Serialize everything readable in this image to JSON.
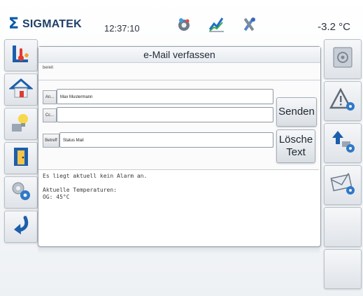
{
  "header": {
    "logo_text": "SIGMATEK",
    "time": "12:37:10",
    "temperature": "-3.2 °C"
  },
  "panel": {
    "title": "e-Mail verfassen",
    "status": "bereit"
  },
  "form": {
    "to_label": "An...",
    "to_value": "Max Mustermann",
    "cc_label": "Cc...",
    "cc_value": "",
    "subject_label": "Betreff",
    "subject_value": "Status Mail",
    "send_label": "Senden",
    "delete_label_line1": "Lösche",
    "delete_label_line2": "Text"
  },
  "body_text": {
    "line1": "Es liegt aktuell kein Alarm an.",
    "line2": "Aktuelle Temperaturen:",
    "line3": "OG: 45°C"
  },
  "colors": {
    "brand_blue": "#0a5aa8",
    "accent_orange": "#e58a1f"
  },
  "icons": {
    "left": [
      "thermometer-icon",
      "house-icon",
      "lightbulb-icon",
      "door-icon",
      "gears-icon",
      "back-arrow-icon"
    ],
    "right": [
      "safe-icon",
      "warning-settings-icon",
      "upload-settings-icon",
      "email-settings-icon"
    ],
    "header": [
      "gear-status-icon",
      "trend-chart-icon",
      "tools-icon"
    ]
  }
}
